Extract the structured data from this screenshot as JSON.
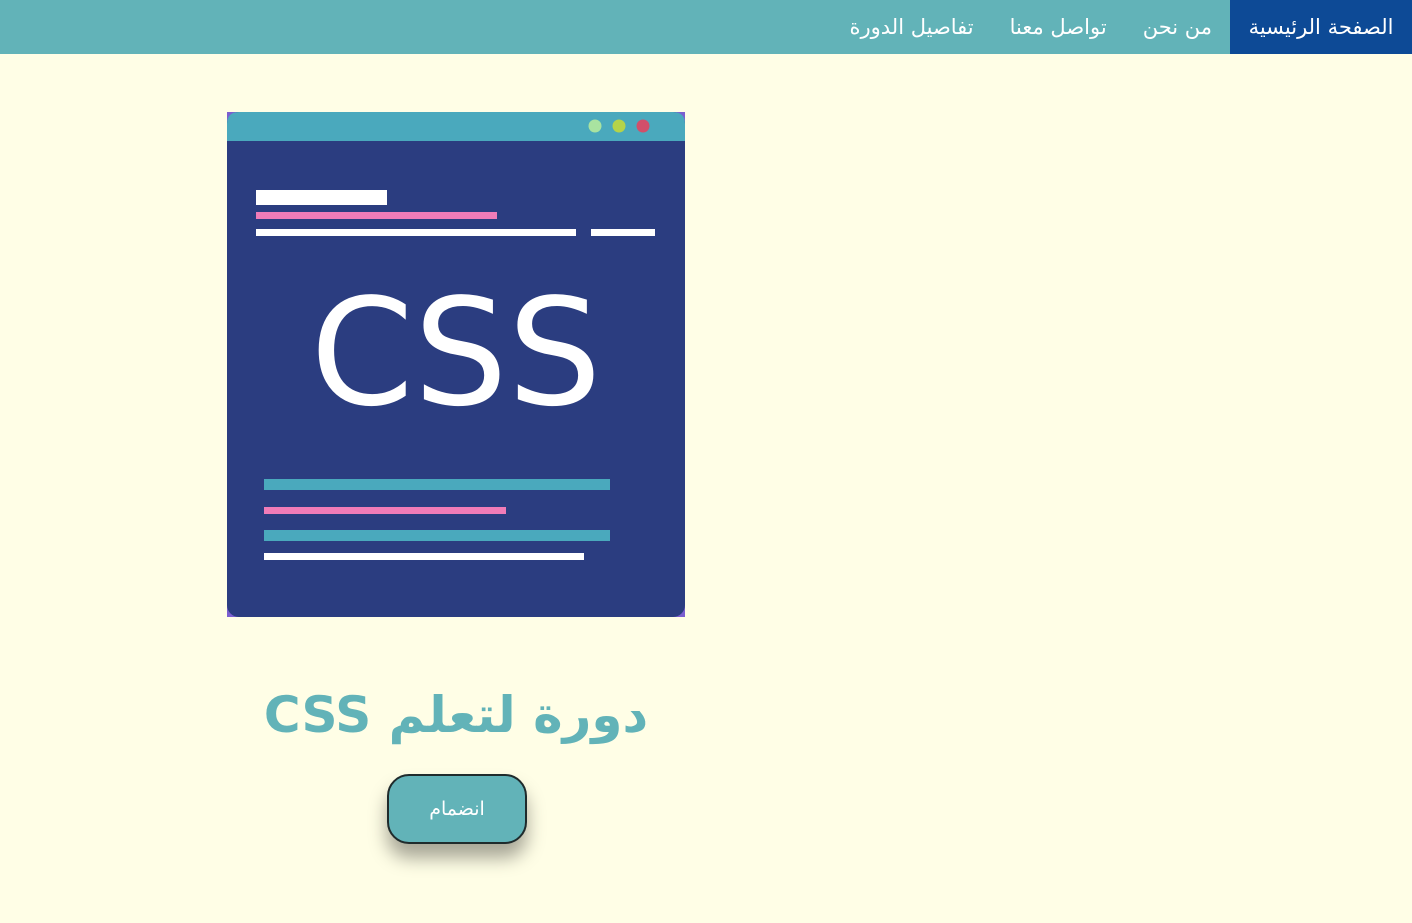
{
  "nav": {
    "items": [
      {
        "label": "الصفحة الرئيسية",
        "active": true
      },
      {
        "label": "من نحن",
        "active": false
      },
      {
        "label": "تواصل معنا",
        "active": false
      },
      {
        "label": "تفاصيل الدورة",
        "active": false
      }
    ]
  },
  "image": {
    "text": "CSS"
  },
  "course": {
    "title": "دورة لتعلم CSS",
    "join_label": "انضمام"
  },
  "colors": {
    "background": "#fffee6",
    "nav_bg": "#62b3b8",
    "nav_active_bg": "#0d4a96",
    "accent": "#62b3b8",
    "window_body": "#2b3d80",
    "window_bar": "#4aa9bd",
    "pink": "#f07cb8"
  },
  "icons": {
    "window_dots": [
      "green-dot",
      "yellow-dot",
      "red-dot"
    ]
  }
}
